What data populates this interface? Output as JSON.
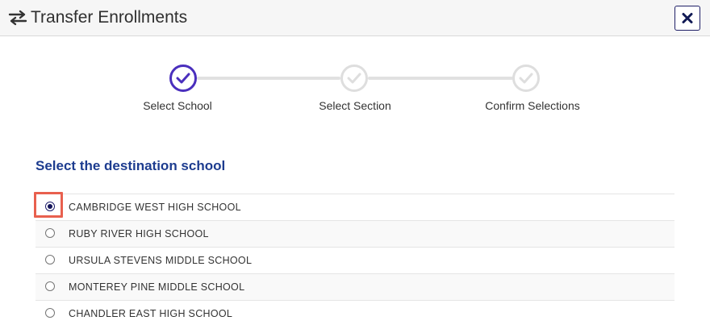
{
  "modal": {
    "title": "Transfer Enrollments",
    "title_icon": "swap-arrows-icon",
    "close_icon": "close-icon"
  },
  "stepper": {
    "steps": [
      {
        "label": "Select School",
        "state": "active"
      },
      {
        "label": "Select Section",
        "state": "inactive"
      },
      {
        "label": "Confirm Selections",
        "state": "inactive"
      }
    ]
  },
  "content": {
    "heading": "Select the destination school",
    "schools": [
      {
        "name": "CAMBRIDGE WEST HIGH SCHOOL",
        "selected": true
      },
      {
        "name": "RUBY RIVER HIGH SCHOOL",
        "selected": false
      },
      {
        "name": "URSULA STEVENS MIDDLE SCHOOL",
        "selected": false
      },
      {
        "name": "MONTEREY PINE MIDDLE SCHOOL",
        "selected": false
      },
      {
        "name": "CHANDLER EAST HIGH SCHOOL",
        "selected": false
      }
    ]
  },
  "colors": {
    "accent": "#4a2fbd",
    "heading": "#1d3c8f",
    "highlight": "#e8604e",
    "inactive_step": "#dedede"
  }
}
